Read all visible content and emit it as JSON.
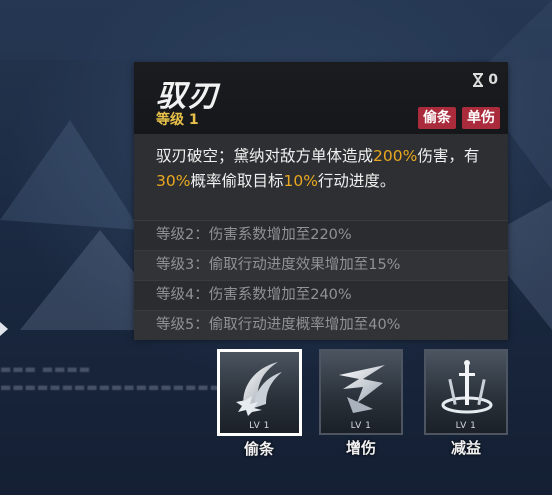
{
  "skill": {
    "name": "驭刃",
    "level": "等级 1",
    "cooldown_count": "0",
    "tags": [
      "偷条",
      "单伤"
    ],
    "description": {
      "p1": "驭刃破空；黛纳对敌方单体造成",
      "dmg": "200%",
      "p2": "伤害，有",
      "chance": "30%",
      "p3": "概率偷取目标",
      "steal": "10%",
      "p4": "行动进度。"
    },
    "upgrades": [
      "等级2：伤害系数增加至220%",
      "等级3：偷取行动进度效果增加至15%",
      "等级4：伤害系数增加至240%",
      "等级5：偷取行动进度概率增加至40%"
    ]
  },
  "skills": [
    {
      "name": "偷条",
      "level": "LV 1",
      "icon": "claw-slash-icon",
      "selected": true
    },
    {
      "name": "增伤",
      "level": "LV 1",
      "icon": "lightning-shield-icon",
      "selected": false
    },
    {
      "name": "减益",
      "level": "LV 1",
      "icon": "sword-altar-icon",
      "selected": false
    }
  ],
  "colors": {
    "highlight": "#e9a820",
    "level": "#e8c14a",
    "tag": "#a92b3c",
    "panel": "#2e2f32"
  }
}
